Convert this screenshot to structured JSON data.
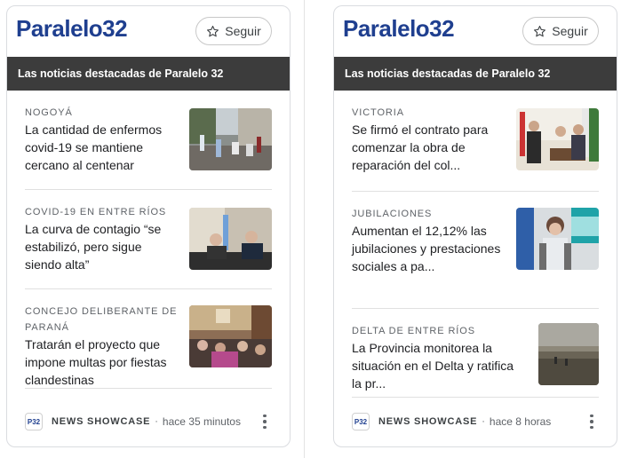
{
  "cards": [
    {
      "logo": "Paralelo",
      "logo_num": "32",
      "follow_label": "Seguir",
      "banner": "Las noticias destacadas de Paralelo 32",
      "articles": [
        {
          "kicker": "NOGOYÁ",
          "headline": "La cantidad de enfermos covid-19 se mantiene cercano al centenar"
        },
        {
          "kicker": "COVID-19 EN ENTRE RÍOS",
          "headline": "La curva de contagio “se estabilizó, pero sigue siendo alta”"
        },
        {
          "kicker": "CONCEJO DELIBERANTE DE PARANÁ",
          "headline": "Tratarán el proyecto que impone multas por fiestas clandestinas"
        }
      ],
      "footer": {
        "pub_icon": "P32",
        "source": "NEWS SHOWCASE",
        "dot": "·",
        "time": "hace 35 minutos"
      }
    },
    {
      "logo": "Paralelo",
      "logo_num": "32",
      "follow_label": "Seguir",
      "banner": "Las noticias destacadas de Paralelo 32",
      "articles": [
        {
          "kicker": "VICTORIA",
          "headline": "Se firmó el contrato para comenzar la obra de reparación del col..."
        },
        {
          "kicker": "JUBILACIONES",
          "headline": "Aumentan el 12,12% las jubilaciones y prestaciones sociales a pa..."
        },
        {
          "kicker": "DELTA DE ENTRE RÍOS",
          "headline": "La Provincia monitorea la situación en el Delta y ratifica la pr..."
        }
      ],
      "footer": {
        "pub_icon": "P32",
        "source": "NEWS SHOWCASE",
        "dot": "·",
        "time": "hace 8 horas"
      }
    }
  ],
  "colors": {
    "brand": "#1f3f8f",
    "banner_bg": "#3c3c3c"
  }
}
